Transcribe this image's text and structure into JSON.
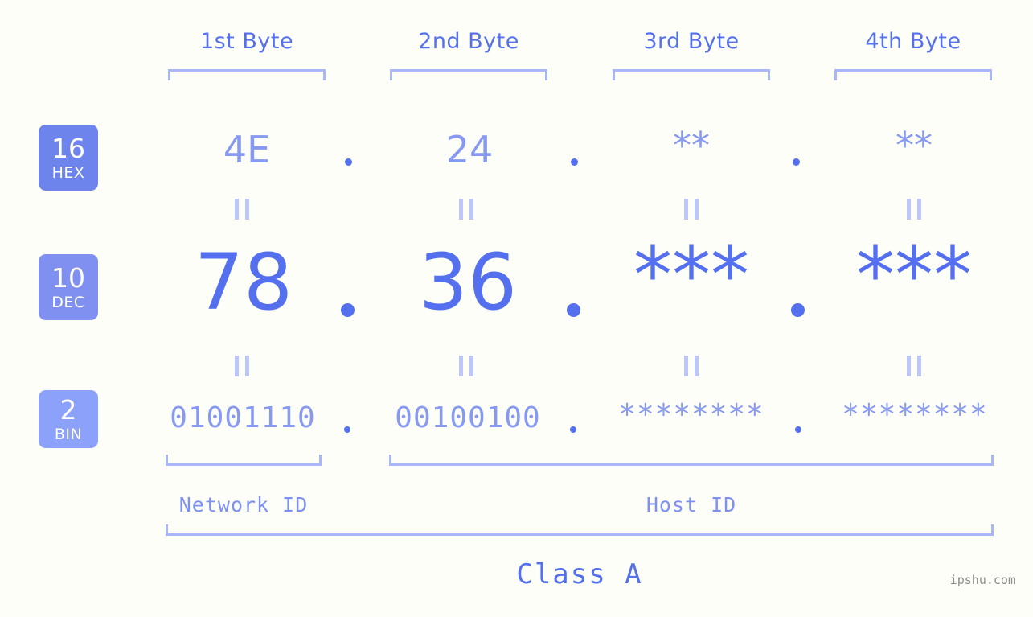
{
  "background_color": "#fdfef7",
  "accent_color": "#5570ee",
  "accent_light": "#8799f0",
  "bracket_color": "#aab7f7",
  "byte_headers": [
    {
      "label": "1st Byte"
    },
    {
      "label": "2nd Byte"
    },
    {
      "label": "3rd Byte"
    },
    {
      "label": "4th Byte"
    }
  ],
  "rows": [
    {
      "badge_number": "16",
      "badge_name": "HEX",
      "badge_color": "#6d84ec",
      "values": [
        "4E",
        "24",
        "**",
        "**"
      ],
      "separator": "."
    },
    {
      "badge_number": "10",
      "badge_name": "DEC",
      "badge_color": "#8090f0",
      "values": [
        "78",
        "36",
        "***",
        "***"
      ],
      "separator": "."
    },
    {
      "badge_number": "2",
      "badge_name": "BIN",
      "badge_color": "#8ca2fa",
      "values": [
        "01001110",
        "00100100",
        "********",
        "********"
      ],
      "separator": "."
    }
  ],
  "connector_symbol": "=",
  "footer": {
    "network_id_label": "Network ID",
    "host_id_label": "Host ID",
    "class_label": "Class A"
  },
  "watermark": "ipshu.com"
}
